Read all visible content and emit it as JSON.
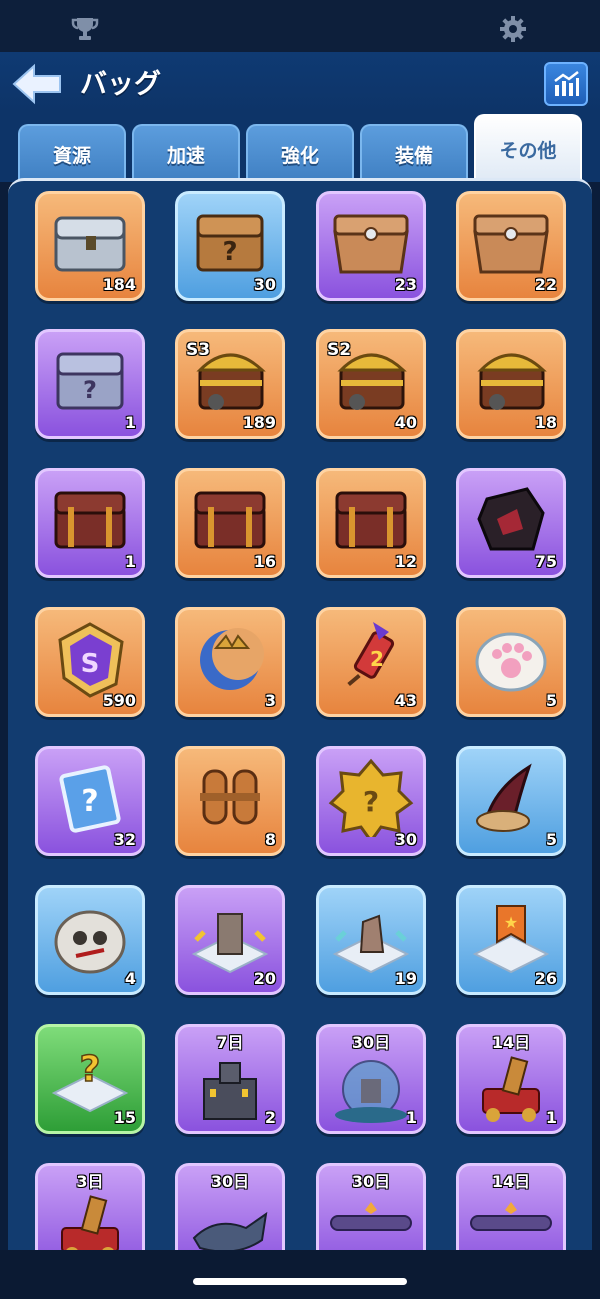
{
  "title": "バッグ",
  "tabs": [
    {
      "label": "資源",
      "active": false
    },
    {
      "label": "加速",
      "active": false
    },
    {
      "label": "強化",
      "active": false
    },
    {
      "label": "装備",
      "active": false
    },
    {
      "label": "その他",
      "active": true
    }
  ],
  "icons": {
    "top_left": "trophy-icon",
    "top_right": "gear-icon",
    "back": "back-arrow-icon",
    "stats": "stats-chart-icon"
  },
  "items": [
    {
      "kind": "silver-chest",
      "color": "orange",
      "count": "184"
    },
    {
      "kind": "mystery-chest",
      "color": "blue",
      "count": "30"
    },
    {
      "kind": "wood-chest",
      "color": "purple",
      "count": "23"
    },
    {
      "kind": "wood-chest",
      "color": "orange",
      "count": "22"
    },
    {
      "kind": "purple-mystery-chest",
      "color": "purple",
      "count": "1"
    },
    {
      "kind": "gold-chest",
      "color": "orange",
      "count": "189",
      "season": "S3"
    },
    {
      "kind": "gold-chest",
      "color": "orange",
      "count": "40",
      "season": "S2"
    },
    {
      "kind": "gold-chest",
      "color": "orange",
      "count": "18"
    },
    {
      "kind": "red-chest",
      "color": "purple",
      "count": "1"
    },
    {
      "kind": "red-chest",
      "color": "orange",
      "count": "16"
    },
    {
      "kind": "red-chest",
      "color": "orange",
      "count": "12"
    },
    {
      "kind": "dark-crystal",
      "color": "purple",
      "count": "75"
    },
    {
      "kind": "purple-shard",
      "color": "orange",
      "count": "590"
    },
    {
      "kind": "moon-crown",
      "color": "orange",
      "count": "3"
    },
    {
      "kind": "firework-rocket",
      "color": "orange",
      "count": "43"
    },
    {
      "kind": "paw-token",
      "color": "orange",
      "count": "5"
    },
    {
      "kind": "mystery-card",
      "color": "purple",
      "count": "32"
    },
    {
      "kind": "jetpack",
      "color": "orange",
      "count": "8"
    },
    {
      "kind": "mystery-badge",
      "color": "purple",
      "count": "30"
    },
    {
      "kind": "horn",
      "color": "blue",
      "count": "5"
    },
    {
      "kind": "skull-sack",
      "color": "blue",
      "count": "4"
    },
    {
      "kind": "relocate-building",
      "color": "purple",
      "count": "20"
    },
    {
      "kind": "relocate-statue",
      "color": "blue",
      "count": "19"
    },
    {
      "kind": "relocate-banner",
      "color": "blue",
      "count": "26"
    },
    {
      "kind": "relocate-mystery",
      "color": "green",
      "count": "15"
    },
    {
      "kind": "castle-skin",
      "color": "purple",
      "count": "2",
      "label": "7日"
    },
    {
      "kind": "globe-skin",
      "color": "purple",
      "count": "1",
      "label": "30日"
    },
    {
      "kind": "cannon-skin",
      "color": "purple",
      "count": "1",
      "label": "14日"
    },
    {
      "kind": "cannon-skin",
      "color": "purple",
      "count": "",
      "label": "3日"
    },
    {
      "kind": "whale-skin",
      "color": "purple",
      "count": "",
      "label": "30日"
    },
    {
      "kind": "nameplate",
      "color": "purple",
      "count": "",
      "label": "30日"
    },
    {
      "kind": "nameplate",
      "color": "purple",
      "count": "",
      "label": "14日"
    }
  ]
}
